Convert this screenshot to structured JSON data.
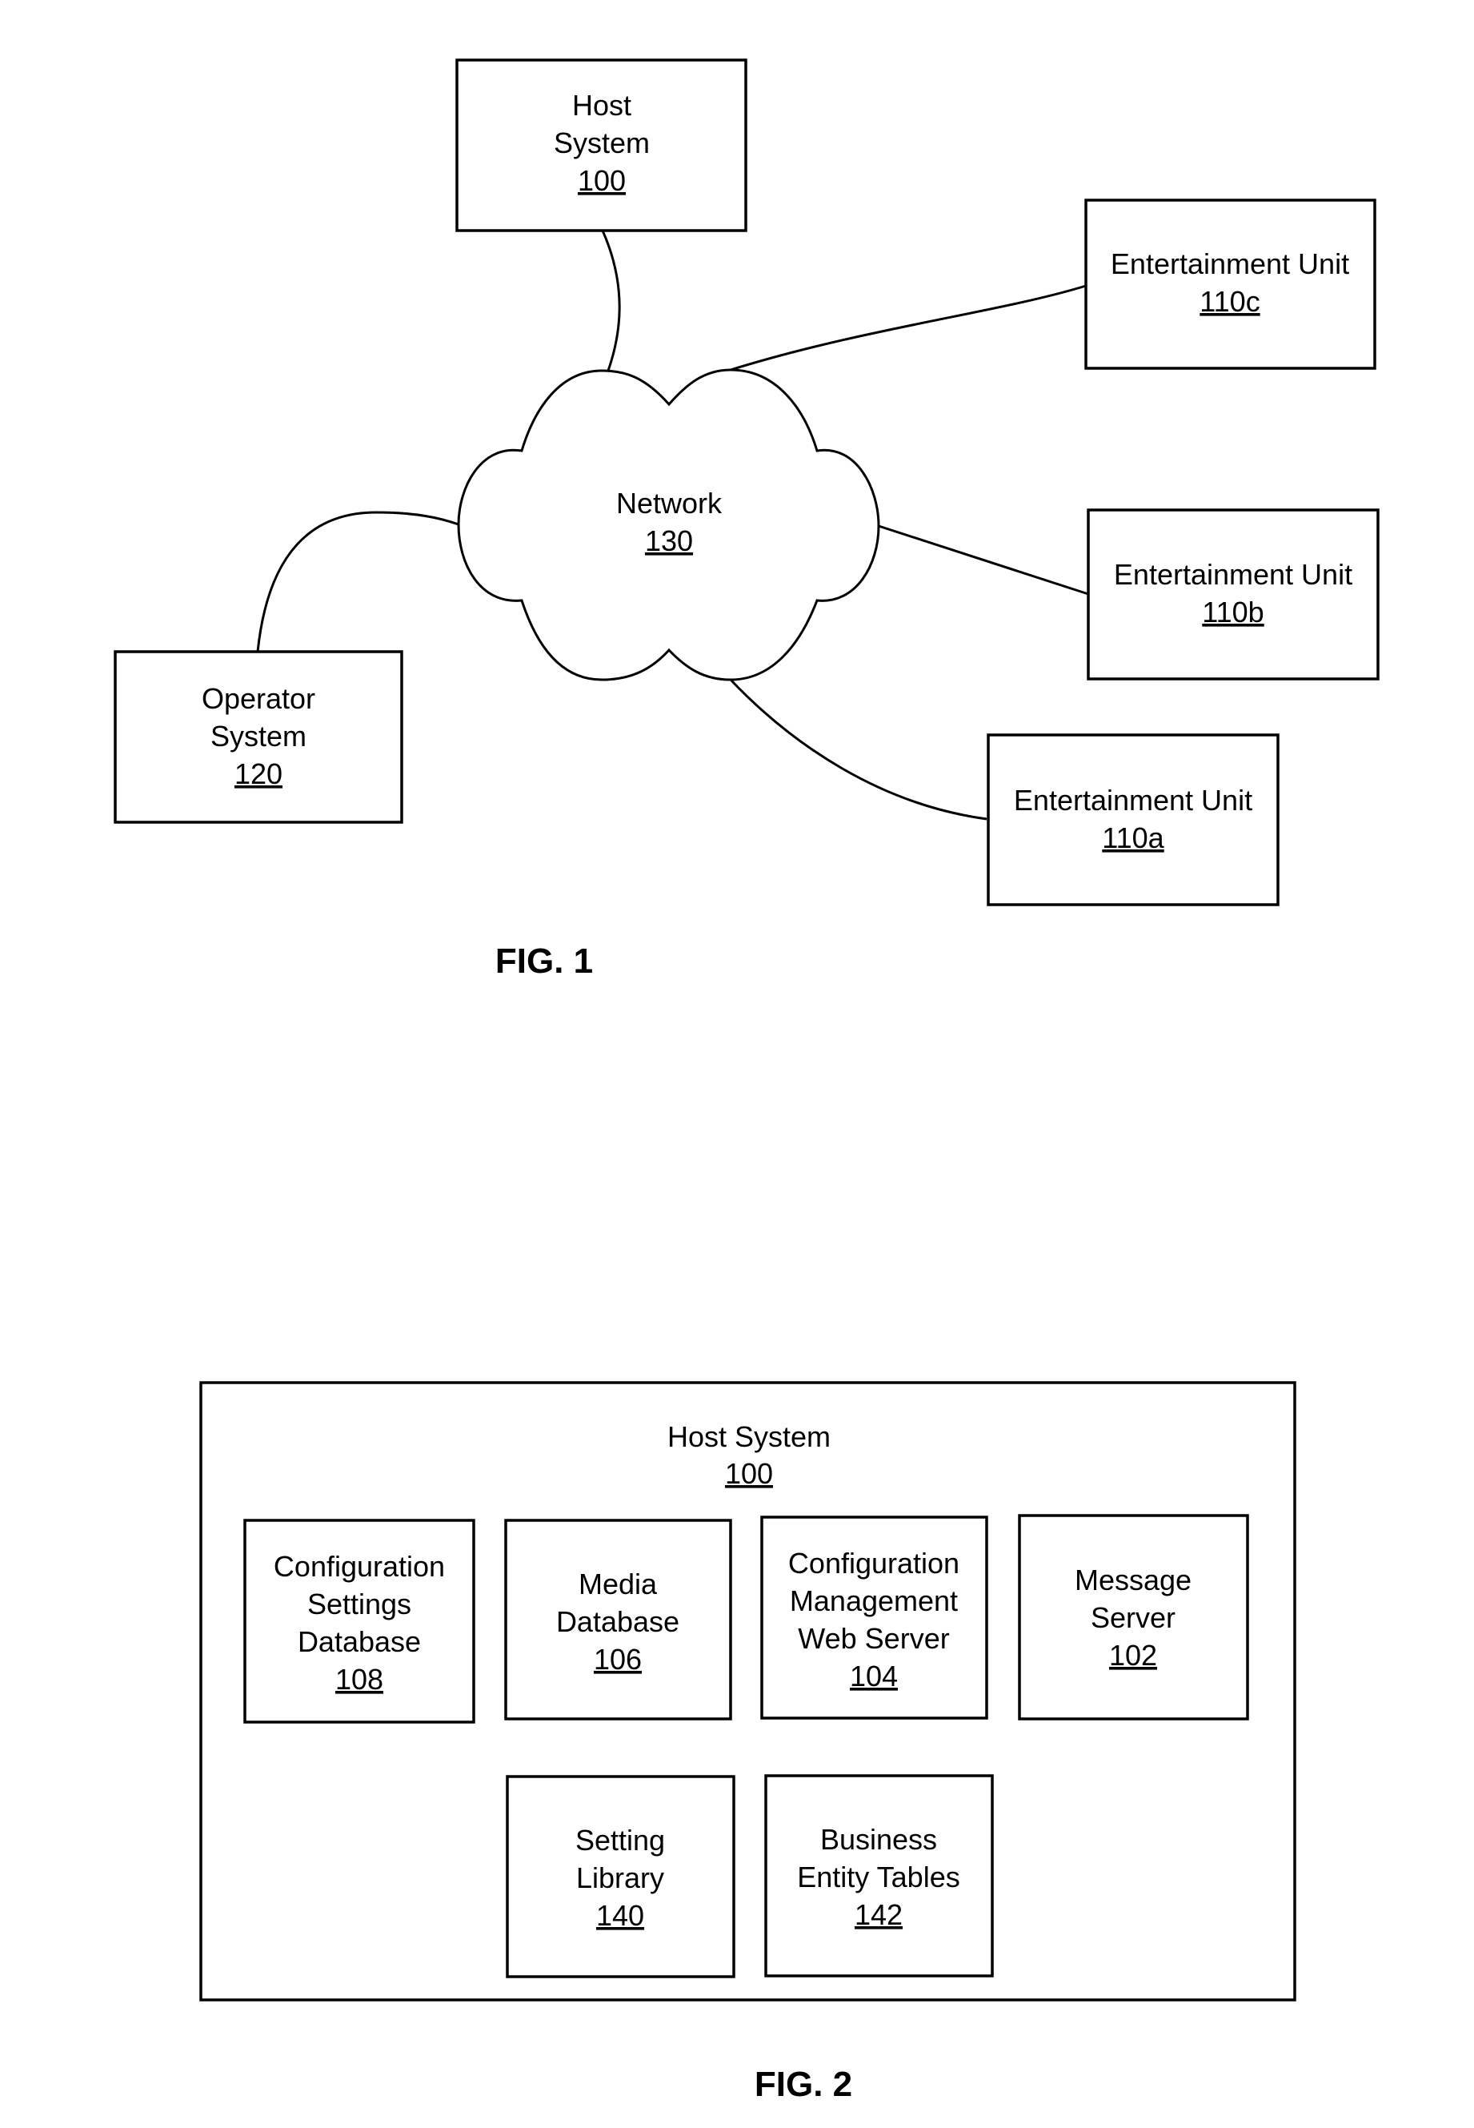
{
  "figure1": {
    "caption": "FIG. 1",
    "nodes": {
      "host": {
        "lines": [
          "Host",
          "System"
        ],
        "ref": "100"
      },
      "network": {
        "lines": [
          "Network"
        ],
        "ref": "130"
      },
      "operator": {
        "lines": [
          "Operator",
          "System"
        ],
        "ref": "120"
      },
      "unit_c": {
        "lines": [
          "Entertainment Unit"
        ],
        "ref": "110c"
      },
      "unit_b": {
        "lines": [
          "Entertainment Unit"
        ],
        "ref": "110b"
      },
      "unit_a": {
        "lines": [
          "Entertainment Unit"
        ],
        "ref": "110a"
      }
    },
    "connections": [
      [
        "host",
        "network"
      ],
      [
        "operator",
        "network"
      ],
      [
        "network",
        "unit_c"
      ],
      [
        "network",
        "unit_b"
      ],
      [
        "network",
        "unit_a"
      ]
    ]
  },
  "figure2": {
    "caption": "FIG. 2",
    "container": {
      "lines": [
        "Host System"
      ],
      "ref": "100"
    },
    "components": {
      "config_db": {
        "lines": [
          "Configuration",
          "Settings",
          "Database"
        ],
        "ref": "108"
      },
      "media_db": {
        "lines": [
          "Media",
          "Database"
        ],
        "ref": "106"
      },
      "config_web": {
        "lines": [
          "Configuration",
          "Management",
          "Web Server"
        ],
        "ref": "104"
      },
      "msg_server": {
        "lines": [
          "Message",
          "Server"
        ],
        "ref": "102"
      },
      "setting_lib": {
        "lines": [
          "Setting",
          "Library"
        ],
        "ref": "140"
      },
      "business": {
        "lines": [
          "Business",
          "Entity Tables"
        ],
        "ref": "142"
      }
    }
  }
}
